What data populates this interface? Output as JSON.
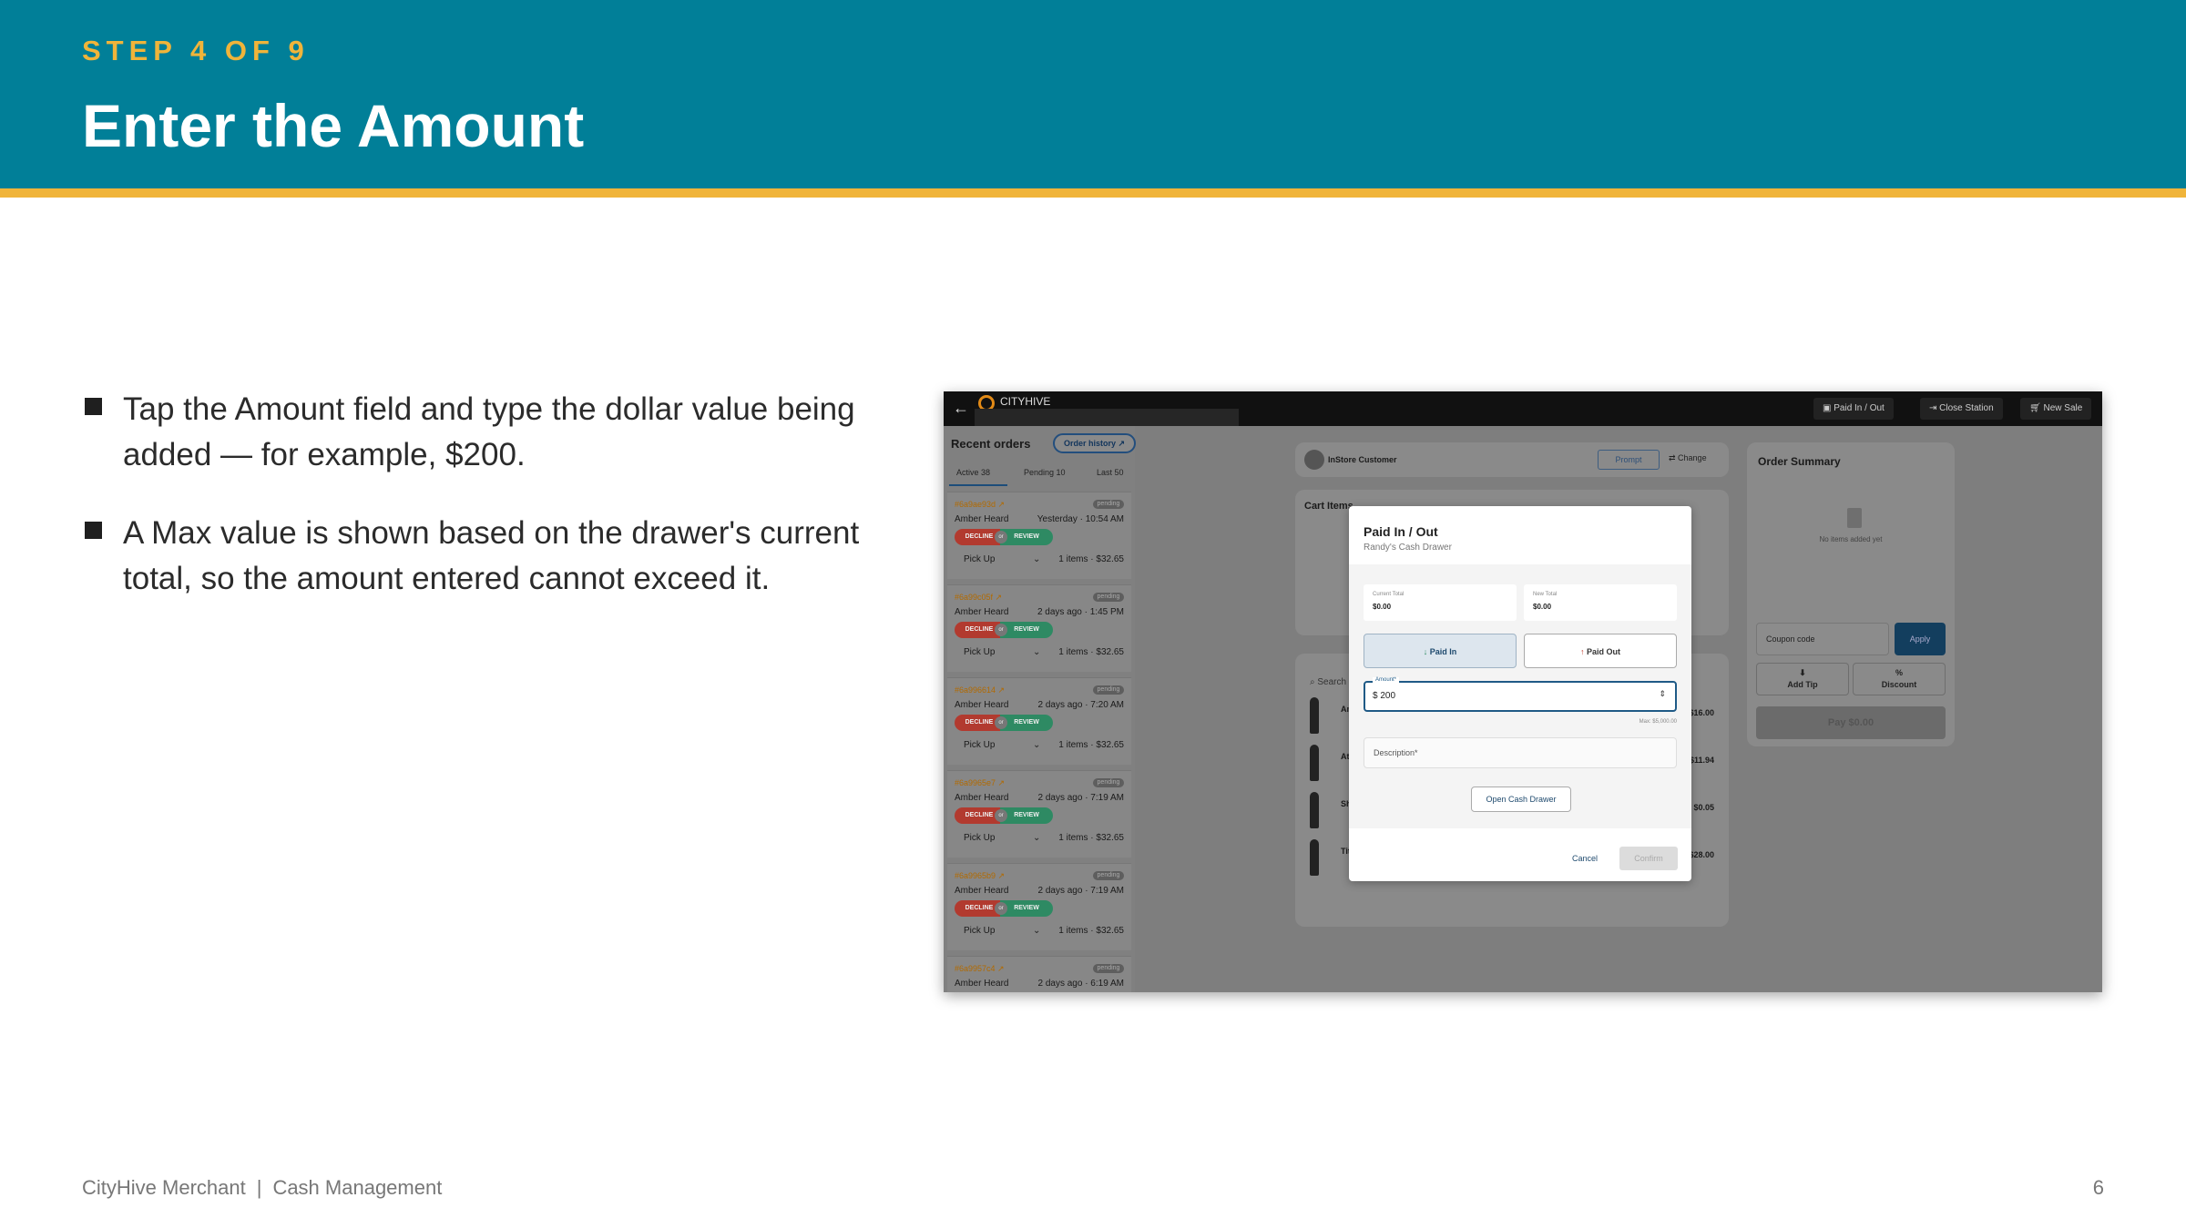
{
  "header": {
    "step": "STEP 4 OF 9",
    "title": "Enter the Amount"
  },
  "bullets": [
    "Tap the Amount field and type the dollar value being added — for example, $200.",
    "A Max value is shown based on the drawer's current total, so the amount entered cannot exceed it."
  ],
  "footer": {
    "product": "CityHive Merchant",
    "separator": "|",
    "section": "Cash Management",
    "page": "6"
  },
  "colors": {
    "header_bg": "#017f98",
    "accent": "#f0b43a"
  },
  "screenshot": {
    "topbar": {
      "logo": "CITYHIVE",
      "buttons": [
        "Paid In / Out",
        "Close Station",
        "New Sale"
      ]
    },
    "recent_orders": {
      "title": "Recent orders",
      "history_button": "Order history ↗",
      "tabs": [
        "Active 38",
        "Pending 10",
        "Last 50"
      ],
      "orders": [
        {
          "id": "#6a9ae93d ↗",
          "status": "pending",
          "name": "Amber Heard",
          "time": "Yesterday · 10:54 AM",
          "decline": "DECLINE",
          "or": "or",
          "review": "REVIEW",
          "pickup": "Pick Up",
          "total": "1 items · $32.65"
        },
        {
          "id": "#6a99c05f ↗",
          "status": "pending",
          "name": "Amber Heard",
          "time": "2 days ago · 1:45 PM",
          "decline": "DECLINE",
          "or": "or",
          "review": "REVIEW",
          "pickup": "Pick Up",
          "total": "1 items · $32.65"
        },
        {
          "id": "#6a996614 ↗",
          "status": "pending",
          "name": "Amber Heard",
          "time": "2 days ago · 7:20 AM",
          "decline": "DECLINE",
          "or": "or",
          "review": "REVIEW",
          "pickup": "Pick Up",
          "total": "1 items · $32.65"
        },
        {
          "id": "#6a9965e7 ↗",
          "status": "pending",
          "name": "Amber Heard",
          "time": "2 days ago · 7:19 AM",
          "decline": "DECLINE",
          "or": "or",
          "review": "REVIEW",
          "pickup": "Pick Up",
          "total": "1 items · $32.65"
        },
        {
          "id": "#6a9965b9 ↗",
          "status": "pending",
          "name": "Amber Heard",
          "time": "2 days ago · 7:19 AM",
          "decline": "DECLINE",
          "or": "or",
          "review": "REVIEW",
          "pickup": "Pick Up",
          "total": "1 items · $32.65"
        },
        {
          "id": "#6a9957c4 ↗",
          "status": "pending",
          "name": "Amber Heard",
          "time": "2 days ago · 6:19 AM",
          "decline": "DECLINE",
          "or": "or",
          "review": "REVIEW",
          "pickup": "Pick Up",
          "total": "1 items · $32.65"
        }
      ]
    },
    "customer": {
      "name": "InStore Customer",
      "prompt": "Prompt",
      "change": "⇄ Change"
    },
    "cart": {
      "title": "Cart Items",
      "search": "Search",
      "items": [
        {
          "name": "Am",
          "price": "$16.00"
        },
        {
          "name": "Att",
          "price": "$11.94"
        },
        {
          "name": "Sh",
          "price": "$0.05"
        },
        {
          "name": "Tit",
          "price": "$28.00"
        }
      ]
    },
    "order_summary": {
      "title": "Order Summary",
      "empty": "No items added yet",
      "coupon_placeholder": "Coupon code",
      "apply": "Apply",
      "add_tip": "Add Tip",
      "discount": "Discount",
      "pay": "Pay $0.00"
    },
    "modal": {
      "title": "Paid In / Out",
      "subtitle": "Randy's Cash Drawer",
      "current_total_label": "Current Total",
      "current_total": "$0.00",
      "new_total_label": "New Total",
      "new_total": "$0.00",
      "paid_in": "Paid In",
      "paid_out": "Paid Out",
      "amount_label": "Amount*",
      "amount_value": "$ 200",
      "max": "Max: $5,000.00",
      "description_placeholder": "Description*",
      "open_drawer": "Open Cash Drawer",
      "cancel": "Cancel",
      "confirm": "Confirm"
    }
  }
}
